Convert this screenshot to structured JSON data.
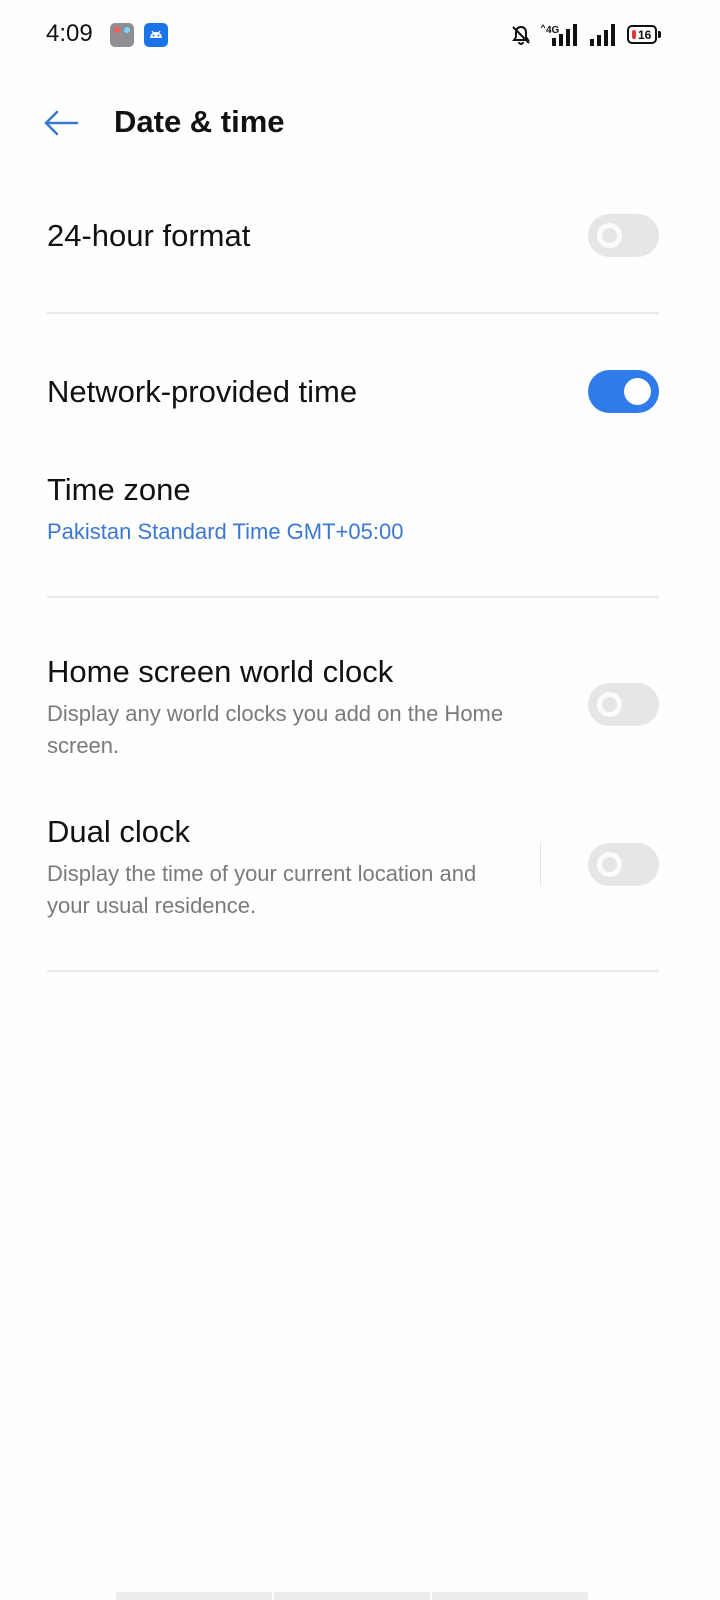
{
  "status_bar": {
    "time": "4:09",
    "network_label": "4G",
    "battery_level": "16",
    "battery_fraction": 0.16,
    "battery_color": "#e53935",
    "icons": [
      "gallery-app-icon",
      "android-app-icon",
      "bell-off-icon",
      "signal-4g-icon",
      "signal-icon",
      "battery-icon"
    ]
  },
  "header": {
    "back_icon": "arrow-left-icon",
    "title": "Date & time"
  },
  "settings": {
    "hour_format": {
      "label": "24-hour format",
      "enabled": false
    },
    "network_time": {
      "label": "Network-provided time",
      "enabled": true
    },
    "time_zone": {
      "label": "Time zone",
      "value": "Pakistan Standard Time GMT+05:00"
    },
    "world_clock": {
      "label": "Home screen world clock",
      "description": "Display any world clocks you add on the Home screen.",
      "enabled": false
    },
    "dual_clock": {
      "label": "Dual clock",
      "description": "Display the time of your current location and your usual residence.",
      "enabled": false
    }
  },
  "colors": {
    "accent": "#2f7bea",
    "link": "#3b78d4",
    "toggle_off": "#e6e6e6",
    "secondary_text": "#7a7a7a"
  }
}
